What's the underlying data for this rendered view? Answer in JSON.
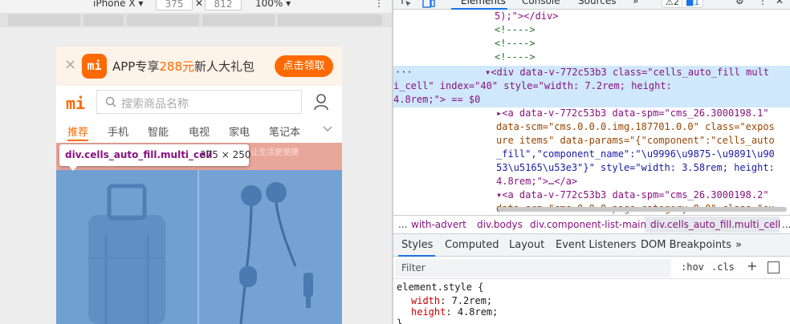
{
  "device_toolbar": {
    "device": "iPhone X ▾",
    "width": "375",
    "x": "✕",
    "height": "812",
    "zoom": "100% ▾"
  },
  "phone": {
    "promo": {
      "close": "×",
      "logo": "mi",
      "text_pre": "APP专享",
      "text_hl": "288元",
      "text_post": "新人大礼包",
      "button": "点击领取"
    },
    "search": {
      "logo": "mi",
      "placeholder": "搜索商品名称"
    },
    "categories": [
      "推荐",
      "手机",
      "智能",
      "电视",
      "家电",
      "笔记本"
    ],
    "banner_text": "让生活更便捷",
    "tooltip": {
      "selector": "div.cells_auto_fill.multi_cell",
      "size": "375 × 250"
    }
  },
  "devtools": {
    "tabs": [
      "Elements",
      "Console",
      "Sources",
      "»"
    ],
    "warnings": "⚠2",
    "messages": "■1",
    "tree": {
      "l0": "5);\"></div>",
      "c1": "<!---->",
      "c2": "<!---->",
      "c3": "<!---->",
      "sel_dots": "···",
      "sel_1": "▾<div data-v-772c53b3 class=\"cells_auto_fill mult",
      "sel_2": "i_cell\" index=\"40\" style=\"width: 7.2rem; height:",
      "sel_3": "4.8rem;\"> == $0",
      "a1_1": "▸<a data-v-772c53b3 data-spm=\"cms_26.3000198.1\"",
      "a1_2": "data-scm=\"cms.0.0.0.img.187701.0.0\" class=\"expos",
      "a1_3": "ure items\" data-params=\"{\"component\":\"cells_auto",
      "a1_4": "_fill\",\"component_name\":\"\\u9996\\u9875-\\u9891\\u90",
      "a1_5": "53\\u5165\\u53e3\"}\" style=\"width: 3.58rem; height:",
      "a1_6": "4.8rem;\">…</a>",
      "a2_1": "▾<a data-v-772c53b3 data-spm=\"cms_26.3000198.2\"",
      "a2_2": "data-scm=\"cms.0.0.0.page.category.0.0\" class=\"ex"
    },
    "breadcrumbs": [
      "...",
      "with-advert",
      "div.bodys",
      "div.component-list-main",
      "div.cells_auto_fill.multi_cell",
      "..."
    ],
    "subtabs": [
      "Styles",
      "Computed",
      "Layout",
      "Event Listeners",
      "DOM Breakpoints",
      "»"
    ],
    "filter": {
      "placeholder": "Filter",
      "hov": ":hov",
      "cls": ".cls",
      "plus": "+"
    },
    "styles": {
      "selector": "element.style {",
      "p1_name": "width",
      "p1_val": "7.2rem;",
      "p2_name": "height",
      "p2_val": "4.8rem;",
      "close": "}"
    }
  }
}
